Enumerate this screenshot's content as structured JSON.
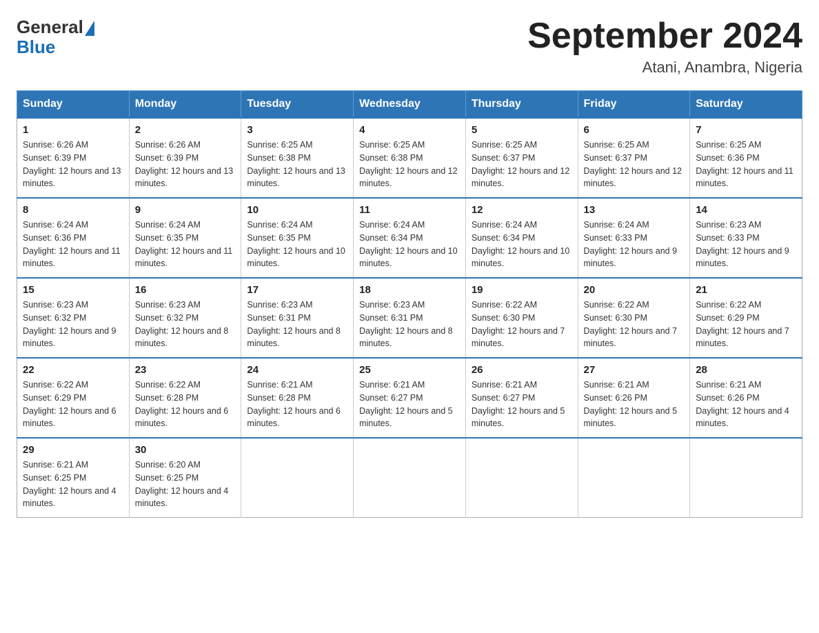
{
  "header": {
    "logo": {
      "general": "General",
      "blue": "Blue"
    },
    "title": "September 2024",
    "location": "Atani, Anambra, Nigeria"
  },
  "calendar": {
    "days_of_week": [
      "Sunday",
      "Monday",
      "Tuesday",
      "Wednesday",
      "Thursday",
      "Friday",
      "Saturday"
    ],
    "weeks": [
      [
        {
          "day": "1",
          "sunrise": "6:26 AM",
          "sunset": "6:39 PM",
          "daylight": "12 hours and 13 minutes."
        },
        {
          "day": "2",
          "sunrise": "6:26 AM",
          "sunset": "6:39 PM",
          "daylight": "12 hours and 13 minutes."
        },
        {
          "day": "3",
          "sunrise": "6:25 AM",
          "sunset": "6:38 PM",
          "daylight": "12 hours and 13 minutes."
        },
        {
          "day": "4",
          "sunrise": "6:25 AM",
          "sunset": "6:38 PM",
          "daylight": "12 hours and 12 minutes."
        },
        {
          "day": "5",
          "sunrise": "6:25 AM",
          "sunset": "6:37 PM",
          "daylight": "12 hours and 12 minutes."
        },
        {
          "day": "6",
          "sunrise": "6:25 AM",
          "sunset": "6:37 PM",
          "daylight": "12 hours and 12 minutes."
        },
        {
          "day": "7",
          "sunrise": "6:25 AM",
          "sunset": "6:36 PM",
          "daylight": "12 hours and 11 minutes."
        }
      ],
      [
        {
          "day": "8",
          "sunrise": "6:24 AM",
          "sunset": "6:36 PM",
          "daylight": "12 hours and 11 minutes."
        },
        {
          "day": "9",
          "sunrise": "6:24 AM",
          "sunset": "6:35 PM",
          "daylight": "12 hours and 11 minutes."
        },
        {
          "day": "10",
          "sunrise": "6:24 AM",
          "sunset": "6:35 PM",
          "daylight": "12 hours and 10 minutes."
        },
        {
          "day": "11",
          "sunrise": "6:24 AM",
          "sunset": "6:34 PM",
          "daylight": "12 hours and 10 minutes."
        },
        {
          "day": "12",
          "sunrise": "6:24 AM",
          "sunset": "6:34 PM",
          "daylight": "12 hours and 10 minutes."
        },
        {
          "day": "13",
          "sunrise": "6:24 AM",
          "sunset": "6:33 PM",
          "daylight": "12 hours and 9 minutes."
        },
        {
          "day": "14",
          "sunrise": "6:23 AM",
          "sunset": "6:33 PM",
          "daylight": "12 hours and 9 minutes."
        }
      ],
      [
        {
          "day": "15",
          "sunrise": "6:23 AM",
          "sunset": "6:32 PM",
          "daylight": "12 hours and 9 minutes."
        },
        {
          "day": "16",
          "sunrise": "6:23 AM",
          "sunset": "6:32 PM",
          "daylight": "12 hours and 8 minutes."
        },
        {
          "day": "17",
          "sunrise": "6:23 AM",
          "sunset": "6:31 PM",
          "daylight": "12 hours and 8 minutes."
        },
        {
          "day": "18",
          "sunrise": "6:23 AM",
          "sunset": "6:31 PM",
          "daylight": "12 hours and 8 minutes."
        },
        {
          "day": "19",
          "sunrise": "6:22 AM",
          "sunset": "6:30 PM",
          "daylight": "12 hours and 7 minutes."
        },
        {
          "day": "20",
          "sunrise": "6:22 AM",
          "sunset": "6:30 PM",
          "daylight": "12 hours and 7 minutes."
        },
        {
          "day": "21",
          "sunrise": "6:22 AM",
          "sunset": "6:29 PM",
          "daylight": "12 hours and 7 minutes."
        }
      ],
      [
        {
          "day": "22",
          "sunrise": "6:22 AM",
          "sunset": "6:29 PM",
          "daylight": "12 hours and 6 minutes."
        },
        {
          "day": "23",
          "sunrise": "6:22 AM",
          "sunset": "6:28 PM",
          "daylight": "12 hours and 6 minutes."
        },
        {
          "day": "24",
          "sunrise": "6:21 AM",
          "sunset": "6:28 PM",
          "daylight": "12 hours and 6 minutes."
        },
        {
          "day": "25",
          "sunrise": "6:21 AM",
          "sunset": "6:27 PM",
          "daylight": "12 hours and 5 minutes."
        },
        {
          "day": "26",
          "sunrise": "6:21 AM",
          "sunset": "6:27 PM",
          "daylight": "12 hours and 5 minutes."
        },
        {
          "day": "27",
          "sunrise": "6:21 AM",
          "sunset": "6:26 PM",
          "daylight": "12 hours and 5 minutes."
        },
        {
          "day": "28",
          "sunrise": "6:21 AM",
          "sunset": "6:26 PM",
          "daylight": "12 hours and 4 minutes."
        }
      ],
      [
        {
          "day": "29",
          "sunrise": "6:21 AM",
          "sunset": "6:25 PM",
          "daylight": "12 hours and 4 minutes."
        },
        {
          "day": "30",
          "sunrise": "6:20 AM",
          "sunset": "6:25 PM",
          "daylight": "12 hours and 4 minutes."
        },
        null,
        null,
        null,
        null,
        null
      ]
    ]
  }
}
